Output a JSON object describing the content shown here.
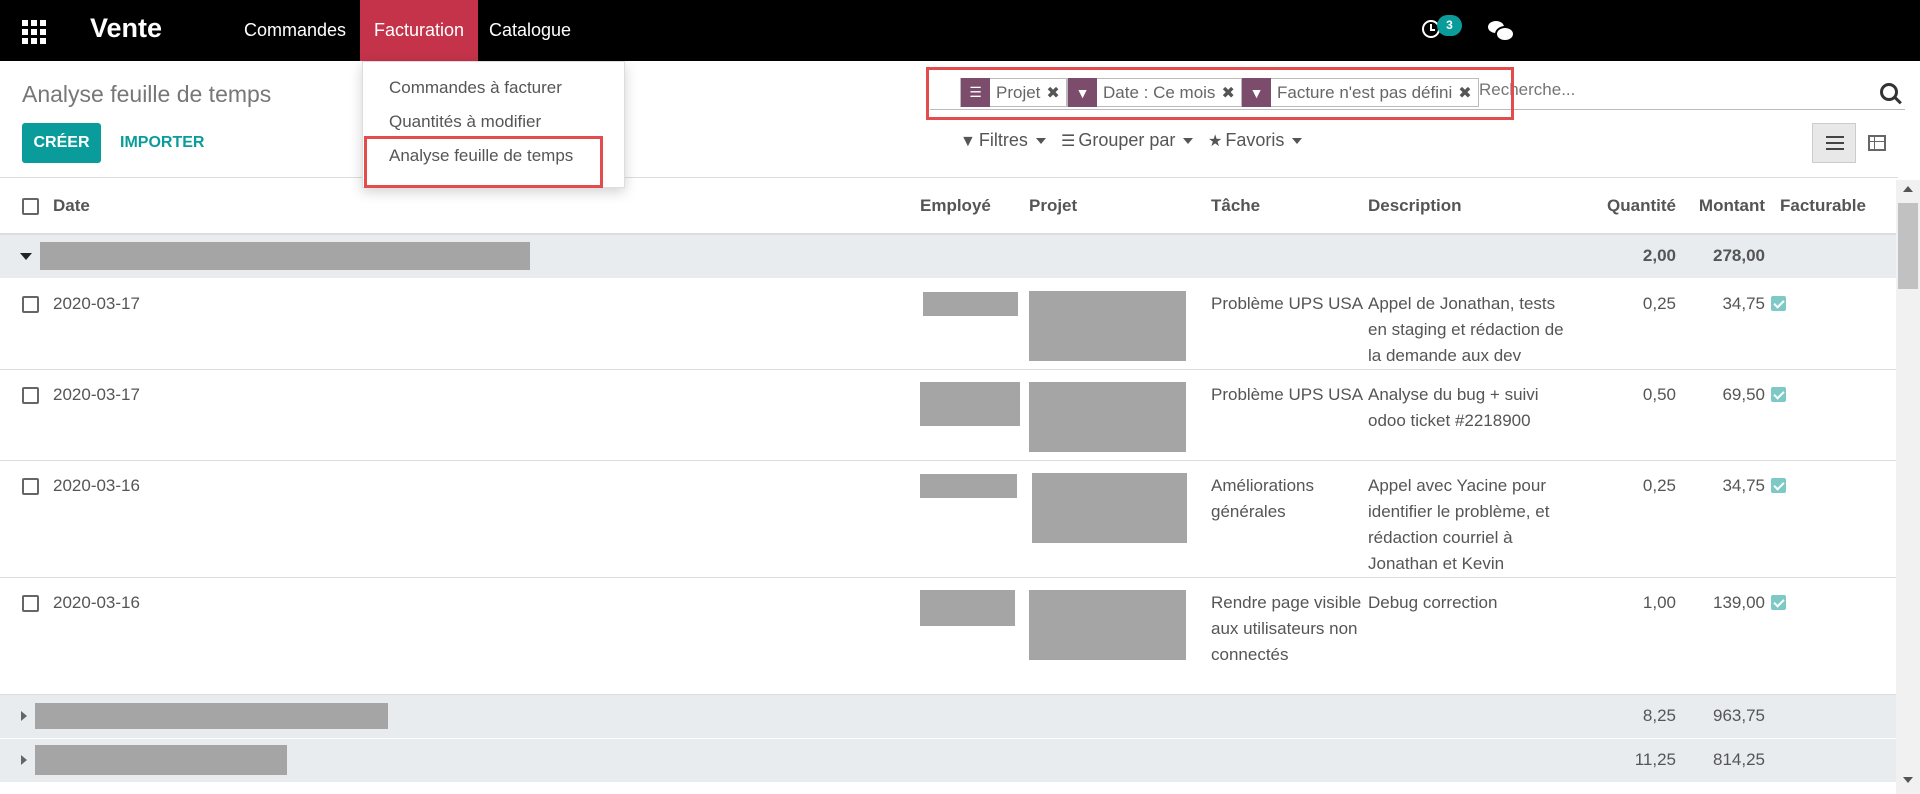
{
  "navbar": {
    "brand": "Vente",
    "menus": [
      "Commandes",
      "Facturation",
      "Catalogue"
    ],
    "activity_count": "3"
  },
  "dropdown": {
    "items": [
      "Commandes à facturer",
      "Quantités à modifier",
      "Analyse feuille de temps"
    ]
  },
  "control_panel": {
    "title": "Analyse feuille de temps",
    "create_label": "CRÉER",
    "import_label": "IMPORTER",
    "facets": [
      {
        "icon": "group-by-icon",
        "label": "Projet"
      },
      {
        "icon": "filter-icon",
        "label": "Date : Ce mois"
      },
      {
        "icon": "filter-icon",
        "label": "Facture n'est pas défini"
      }
    ],
    "search_placeholder": "Recherche...",
    "filters_label": "Filtres",
    "groupby_label": "Grouper par",
    "favorites_label": "Favoris"
  },
  "table": {
    "headers": [
      "Date",
      "Employé",
      "Projet",
      "Tâche",
      "Description",
      "Quantité",
      "Montant",
      "Facturable"
    ],
    "groups": [
      {
        "quantity": "2,00",
        "amount": "278,00"
      },
      {
        "quantity": "8,25",
        "amount": "963,75"
      },
      {
        "quantity": "11,25",
        "amount": "814,25"
      }
    ],
    "rows": [
      {
        "date": "2020-03-17",
        "task": "Problème UPS USA",
        "description": "Appel de Jonathan, tests en staging et rédaction de la demande aux dev",
        "quantity": "0,25",
        "amount": "34,75"
      },
      {
        "date": "2020-03-17",
        "task": "Problème UPS USA",
        "description": "Analyse du bug + suivi odoo ticket #2218900",
        "quantity": "0,50",
        "amount": "69,50"
      },
      {
        "date": "2020-03-16",
        "task": "Améliorations générales",
        "description": "Appel avec Yacine pour identifier le problème, et rédaction courriel à Jonathan et Kevin",
        "quantity": "0,25",
        "amount": "34,75"
      },
      {
        "date": "2020-03-16",
        "task": "Rendre page visible aux utilisateurs non connectés",
        "description": "Debug correction",
        "quantity": "1,00",
        "amount": "139,00"
      }
    ]
  },
  "colors": {
    "navbar_bg": "#000000",
    "active_menu": "#c4334a",
    "primary": "#0a9c9b",
    "facet_icon": "#7c4c6c",
    "highlight": "#e34c4c"
  }
}
